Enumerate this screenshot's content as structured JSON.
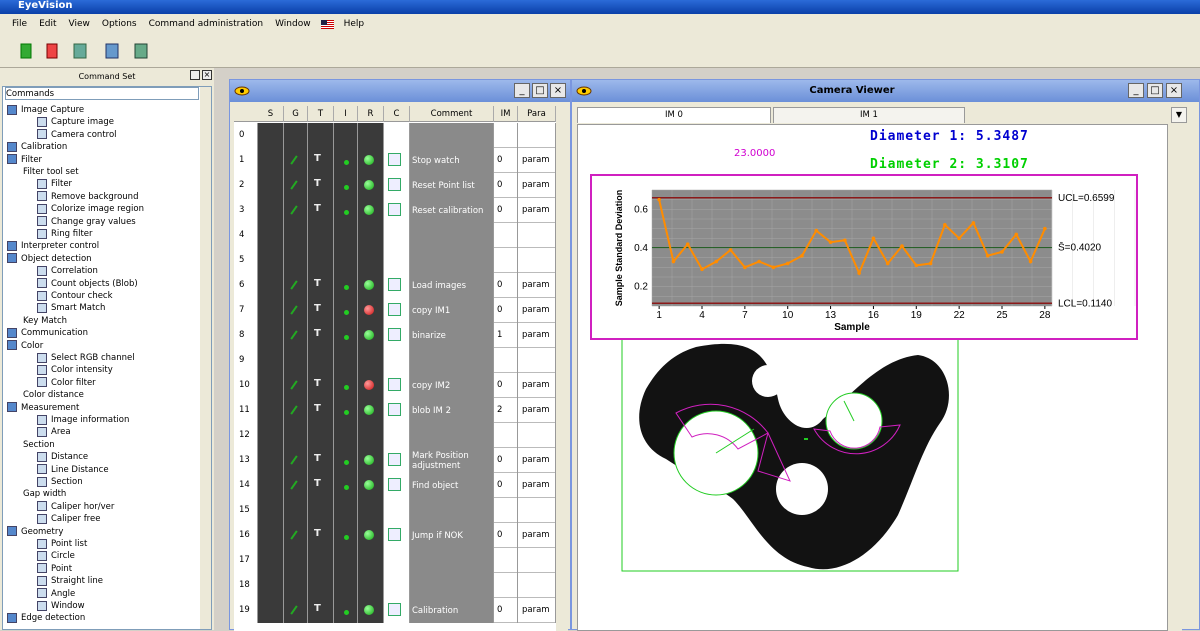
{
  "app": {
    "title": "EyeVision"
  },
  "menu": [
    "File",
    "Edit",
    "View",
    "Options",
    "Command administration",
    "Window",
    "Help"
  ],
  "command_set": {
    "title": "Command Set",
    "root": "Commands",
    "items": [
      {
        "label": "Image Capture",
        "level": 0
      },
      {
        "label": "Capture image",
        "level": 2
      },
      {
        "label": "Camera control",
        "level": 2
      },
      {
        "label": "Calibration",
        "level": 0
      },
      {
        "label": "Filter",
        "level": 0
      },
      {
        "label": "Filter tool set",
        "level": 1
      },
      {
        "label": "Filter",
        "level": 2
      },
      {
        "label": "Remove background",
        "level": 2
      },
      {
        "label": "Colorize image region",
        "level": 2
      },
      {
        "label": "Change gray values",
        "level": 2
      },
      {
        "label": "Ring filter",
        "level": 2
      },
      {
        "label": "Interpreter control",
        "level": 0
      },
      {
        "label": "Object detection",
        "level": 0
      },
      {
        "label": "Correlation",
        "level": 2
      },
      {
        "label": "Count objects (Blob)",
        "level": 2
      },
      {
        "label": "Contour check",
        "level": 2
      },
      {
        "label": "Smart Match",
        "level": 2
      },
      {
        "label": "Key Match",
        "level": 1
      },
      {
        "label": "Communication",
        "level": 0
      },
      {
        "label": "Color",
        "level": 0
      },
      {
        "label": "Select RGB channel",
        "level": 2
      },
      {
        "label": "Color intensity",
        "level": 2
      },
      {
        "label": "Color filter",
        "level": 2
      },
      {
        "label": "Color distance",
        "level": 1
      },
      {
        "label": "Measurement",
        "level": 0
      },
      {
        "label": "Image information",
        "level": 2
      },
      {
        "label": "Area",
        "level": 2
      },
      {
        "label": "Section",
        "level": 1
      },
      {
        "label": "Distance",
        "level": 2
      },
      {
        "label": "Line Distance",
        "level": 2
      },
      {
        "label": "Section",
        "level": 2
      },
      {
        "label": "Gap width",
        "level": 1
      },
      {
        "label": "Caliper hor/ver",
        "level": 2
      },
      {
        "label": "Caliper free",
        "level": 2
      },
      {
        "label": "Geometry",
        "level": 0
      },
      {
        "label": "Point list",
        "level": 2
      },
      {
        "label": "Circle",
        "level": 2
      },
      {
        "label": "Point",
        "level": 2
      },
      {
        "label": "Straight line",
        "level": 2
      },
      {
        "label": "Angle",
        "level": 2
      },
      {
        "label": "Window",
        "level": 2
      },
      {
        "label": "Edge detection",
        "level": 0
      }
    ]
  },
  "sequence": {
    "columns": [
      "S",
      "G",
      "T",
      "I",
      "R",
      "C",
      "Comment",
      "IM",
      "Para"
    ],
    "rows": [
      {
        "n": "0",
        "active": false,
        "comment": "",
        "im": "",
        "para": ""
      },
      {
        "n": "1",
        "active": true,
        "red": false,
        "comment": "Stop watch",
        "im": "0",
        "para": "param"
      },
      {
        "n": "2",
        "active": true,
        "red": false,
        "comment": "Reset Point list",
        "im": "0",
        "para": "param"
      },
      {
        "n": "3",
        "active": true,
        "red": false,
        "comment": "Reset calibration",
        "im": "0",
        "para": "param"
      },
      {
        "n": "4",
        "active": false,
        "comment": "",
        "im": "",
        "para": ""
      },
      {
        "n": "5",
        "active": false,
        "comment": "",
        "im": "",
        "para": ""
      },
      {
        "n": "6",
        "active": true,
        "red": false,
        "comment": "Load images",
        "im": "0",
        "para": "param"
      },
      {
        "n": "7",
        "active": true,
        "red": true,
        "comment": "copy IM1",
        "im": "0",
        "para": "param"
      },
      {
        "n": "8",
        "active": true,
        "red": false,
        "comment": "binarize",
        "im": "1",
        "para": "param"
      },
      {
        "n": "9",
        "active": false,
        "comment": "",
        "im": "",
        "para": ""
      },
      {
        "n": "10",
        "active": true,
        "red": true,
        "comment": "copy IM2",
        "im": "0",
        "para": "param"
      },
      {
        "n": "11",
        "active": true,
        "red": false,
        "comment": "blob IM 2",
        "im": "2",
        "para": "param"
      },
      {
        "n": "12",
        "active": false,
        "comment": "",
        "im": "",
        "para": ""
      },
      {
        "n": "13",
        "active": true,
        "red": false,
        "comment": "Mark Position adjustment",
        "im": "0",
        "para": "param"
      },
      {
        "n": "14",
        "active": true,
        "red": false,
        "comment": "Find object",
        "im": "0",
        "para": "param"
      },
      {
        "n": "15",
        "active": false,
        "comment": "",
        "im": "",
        "para": ""
      },
      {
        "n": "16",
        "active": true,
        "red": false,
        "comment": "Jump if NOK",
        "im": "0",
        "para": "param"
      },
      {
        "n": "17",
        "active": false,
        "comment": "",
        "im": "",
        "para": ""
      },
      {
        "n": "18",
        "active": false,
        "comment": "",
        "im": "",
        "para": ""
      },
      {
        "n": "19",
        "active": true,
        "red": false,
        "comment": "Calibration",
        "im": "0",
        "para": "param"
      }
    ]
  },
  "camera": {
    "title": "Camera Viewer",
    "tabs": [
      "IM 0",
      "IM 1"
    ],
    "diameter1": "Diameter 1: 5.3487",
    "diameter2": "Diameter 2: 3.3107",
    "value": "23.0000"
  },
  "chart_data": {
    "type": "line",
    "title": "",
    "xlabel": "Sample",
    "ylabel": "Sample Standard Deviation",
    "x_ticks": [
      1,
      4,
      7,
      10,
      13,
      16,
      19,
      22,
      25,
      28
    ],
    "y_ticks": [
      0.2,
      0.4,
      0.6
    ],
    "ylim": [
      0.1,
      0.7
    ],
    "xlim": [
      0.5,
      28.5
    ],
    "ucl": 0.6599,
    "mean": 0.402,
    "lcl": 0.114,
    "ucl_label": "UCL=0.6599",
    "mean_label": "S̄=0.4020",
    "lcl_label": "LCL=0.1140",
    "series": [
      {
        "x": [
          1,
          2,
          3,
          4,
          5,
          6,
          7,
          8,
          9,
          10,
          11,
          12,
          13,
          14,
          15,
          16,
          17,
          18,
          19,
          20,
          21,
          22,
          23,
          24,
          25,
          26,
          27,
          28
        ],
        "values": [
          0.65,
          0.33,
          0.42,
          0.29,
          0.33,
          0.39,
          0.3,
          0.33,
          0.3,
          0.32,
          0.36,
          0.49,
          0.43,
          0.44,
          0.27,
          0.45,
          0.32,
          0.41,
          0.31,
          0.32,
          0.52,
          0.45,
          0.53,
          0.36,
          0.38,
          0.47,
          0.33,
          0.5
        ]
      }
    ],
    "colors": {
      "line": "#ff8c00",
      "bg": "#8c8c8c",
      "limit": "#8b1a1a"
    }
  }
}
